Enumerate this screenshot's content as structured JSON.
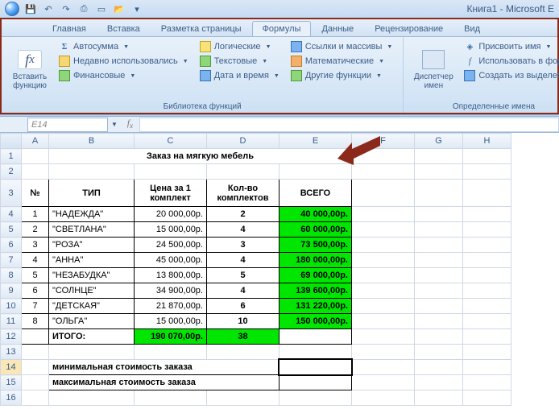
{
  "title": "Книга1 - Microsoft E",
  "qat": [
    "save",
    "undo",
    "redo",
    "print",
    "new",
    "open"
  ],
  "tabs": {
    "home": "Главная",
    "insert": "Вставка",
    "layout": "Разметка страницы",
    "formulas": "Формулы",
    "data": "Данные",
    "review": "Рецензирование",
    "view": "Вид"
  },
  "ribbon": {
    "insert_fn": "Вставить функцию",
    "library_label": "Библиотека функций",
    "autosum": "Автосумма",
    "recent": "Недавно использовались",
    "financial": "Финансовые",
    "logical": "Логические",
    "text": "Текстовые",
    "datetime": "Дата и время",
    "lookup": "Ссылки и массивы",
    "math": "Математические",
    "more": "Другие функции",
    "name_mgr": "Диспетчер имен",
    "define_name": "Присвоить имя",
    "use_in_formula": "Использовать в форму",
    "create_from": "Создать из выделенно",
    "names_label": "Определенные имена"
  },
  "namebox": "E14",
  "columns": [
    "A",
    "B",
    "C",
    "D",
    "E",
    "F",
    "G",
    "H"
  ],
  "sheet": {
    "title_row": "Заказ на мягкую мебель",
    "headers": {
      "no": "№",
      "type": "ТИП",
      "price": "Цена за 1 комплект",
      "qty": "Кол-во комплектов",
      "total": "ВСЕГО"
    },
    "rows": [
      {
        "no": "1",
        "type": "\"НАДЕЖДА\"",
        "price": "20 000,00р.",
        "qty": "2",
        "total": "40 000,00р."
      },
      {
        "no": "2",
        "type": "\"СВЕТЛАНА\"",
        "price": "15 000,00р.",
        "qty": "4",
        "total": "60 000,00р."
      },
      {
        "no": "3",
        "type": "\"РОЗА\"",
        "price": "24 500,00р.",
        "qty": "3",
        "total": "73 500,00р."
      },
      {
        "no": "4",
        "type": "\"АННА\"",
        "price": "45 000,00р.",
        "qty": "4",
        "total": "180 000,00р."
      },
      {
        "no": "5",
        "type": "\"НЕЗАБУДКА\"",
        "price": "13 800,00р.",
        "qty": "5",
        "total": "69 000,00р."
      },
      {
        "no": "6",
        "type": "\"СОЛНЦЕ\"",
        "price": "34 900,00р.",
        "qty": "4",
        "total": "139 600,00р."
      },
      {
        "no": "7",
        "type": "\"ДЕТСКАЯ\"",
        "price": "21 870,00р.",
        "qty": "6",
        "total": "131 220,00р."
      },
      {
        "no": "8",
        "type": "\"ОЛЬГА\"",
        "price": "15 000,00р.",
        "qty": "10",
        "total": "150 000,00р."
      }
    ],
    "totals": {
      "label": "ИТОГО:",
      "price": "190 070,00р.",
      "qty": "38"
    },
    "min_label": "минимальная стоимость заказа",
    "max_label": "максимальная стоимость заказа"
  }
}
